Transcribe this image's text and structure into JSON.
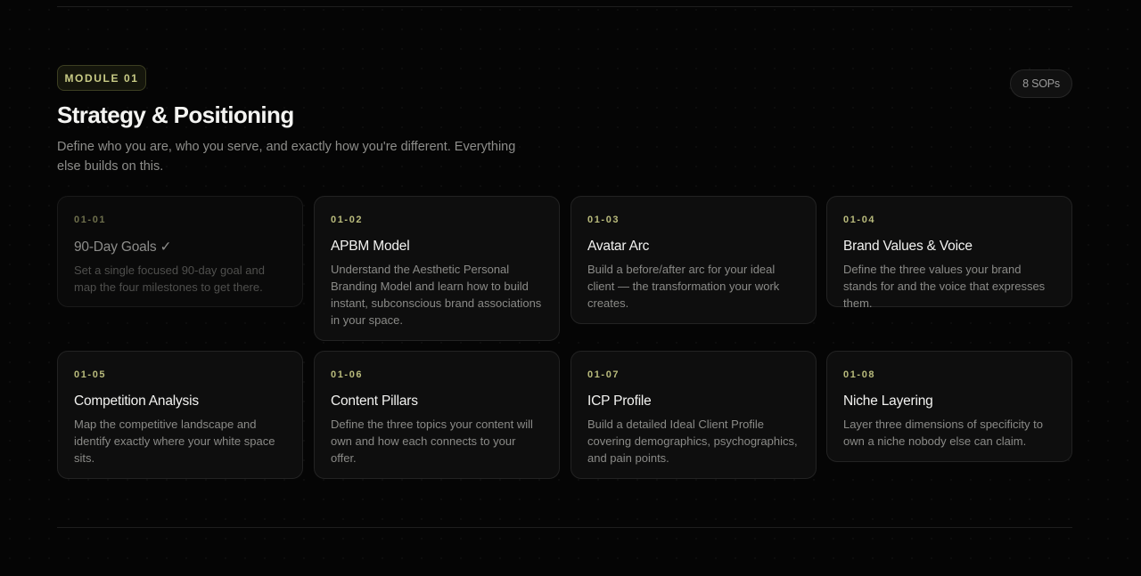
{
  "module": {
    "badge": "MODULE 01",
    "sop_count": "8 SOPs",
    "title": "Strategy & Positioning",
    "description": "Define who you are, who you serve, and exactly how you're different. Everything else builds on this."
  },
  "cards": [
    {
      "code": "01-01",
      "title": "90-Day Goals ✓",
      "description": "Set a single focused 90-day goal and map the four milestones to get there.",
      "completed": true
    },
    {
      "code": "01-02",
      "title": "APBM Model",
      "description": "Understand the Aesthetic Personal Branding Model and learn how to build instant, subconscious brand associations in your space.",
      "completed": false
    },
    {
      "code": "01-03",
      "title": "Avatar Arc",
      "description": "Build a before/after arc for your ideal client — the transformation your work creates.",
      "completed": false
    },
    {
      "code": "01-04",
      "title": "Brand Values & Voice",
      "description": "Define the three values your brand stands for and the voice that expresses them.",
      "completed": false
    },
    {
      "code": "01-05",
      "title": "Competition Analysis",
      "description": "Map the competitive landscape and identify exactly where your white space sits.",
      "completed": false
    },
    {
      "code": "01-06",
      "title": "Content Pillars",
      "description": "Define the three topics your content will own and how each connects to your offer.",
      "completed": false
    },
    {
      "code": "01-07",
      "title": "ICP Profile",
      "description": "Build a detailed Ideal Client Profile covering demographics, psychographics, and pain points.",
      "completed": false
    },
    {
      "code": "01-08",
      "title": "Niche Layering",
      "description": "Layer three dimensions of specificity to own a niche nobody else can claim.",
      "completed": false
    }
  ]
}
